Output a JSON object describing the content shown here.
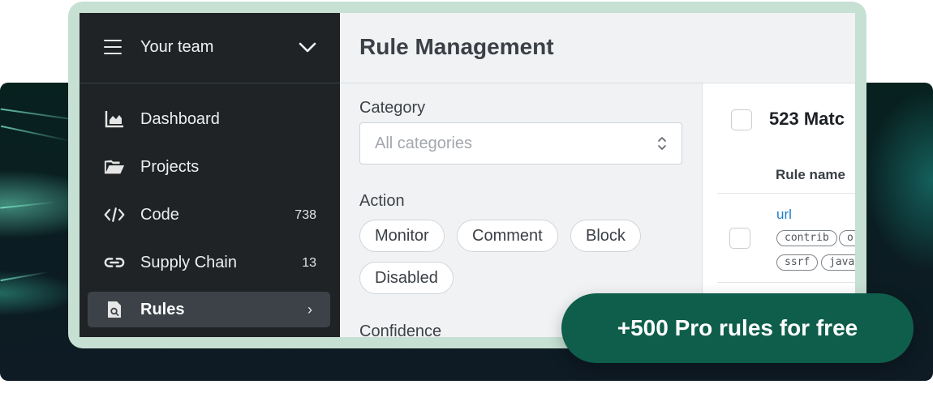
{
  "sidebar": {
    "team_label": "Your team",
    "items": [
      {
        "label": "Dashboard",
        "icon": "chart-icon",
        "count": ""
      },
      {
        "label": "Projects",
        "icon": "folder-icon",
        "count": ""
      },
      {
        "label": "Code",
        "icon": "code-icon",
        "count": "738"
      },
      {
        "label": "Supply Chain",
        "icon": "link-icon",
        "count": "13"
      },
      {
        "label": "Rules",
        "icon": "rule-file-icon",
        "count": "",
        "active": true
      }
    ]
  },
  "header": {
    "title": "Rule Management"
  },
  "filters": {
    "category_label": "Category",
    "category_placeholder": "All categories",
    "action_label": "Action",
    "actions": [
      "Monitor",
      "Comment",
      "Block",
      "Disabled"
    ],
    "confidence_label": "Confidence"
  },
  "results": {
    "count_text": "523 Matc",
    "column_rule_name": "Rule name",
    "rows": [
      {
        "name": "url",
        "tags": [
          "contrib",
          "o",
          "ssrf",
          "java"
        ]
      }
    ]
  },
  "promo": {
    "text": "+500 Pro rules for free"
  },
  "colors": {
    "accent": "#0e5e4b",
    "sidebar": "#1f2326",
    "link": "#1e7fc7",
    "frame": "#c6e0d3"
  }
}
